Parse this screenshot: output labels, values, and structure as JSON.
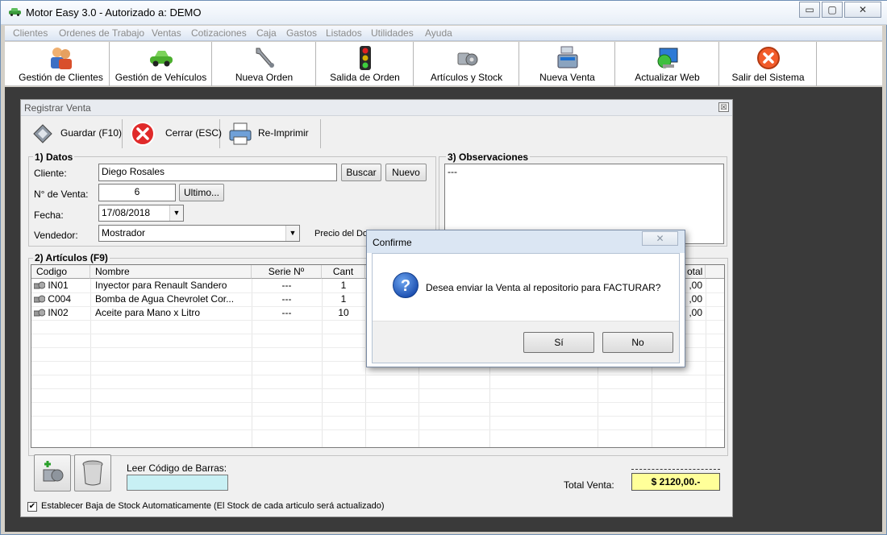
{
  "window": {
    "title": "Motor Easy 3.0 - Autorizado a: DEMO",
    "min": "▭",
    "max": "▢",
    "close": "✕"
  },
  "menu": [
    "Clientes",
    "Ordenes de Trabajo",
    "Ventas",
    "Cotizaciones",
    "Caja",
    "Gastos",
    "Listados",
    "Utilidades",
    "Ayuda"
  ],
  "toolbar": [
    {
      "label": "Gestión de Clientes",
      "icon": "clients-icon"
    },
    {
      "label": "Gestión de Vehículos",
      "icon": "car-icon"
    },
    {
      "label": "Nueva Orden",
      "icon": "wrench-icon"
    },
    {
      "label": "Salida de Orden",
      "icon": "traffic-light-icon"
    },
    {
      "label": "Artículos y Stock",
      "icon": "parts-icon"
    },
    {
      "label": "Nueva Venta",
      "icon": "cash-register-icon"
    },
    {
      "label": "Actualizar Web",
      "icon": "globe-icon"
    },
    {
      "label": "Salir del Sistema",
      "icon": "exit-icon"
    }
  ],
  "child": {
    "title": "Registrar Venta",
    "close": "☒",
    "actions": {
      "save": "Guardar (F10)",
      "close": "Cerrar (ESC)",
      "reprint": "Re-Imprimir"
    },
    "datos": {
      "legend": "1) Datos",
      "cliente_label": "Cliente:",
      "cliente_value": "Diego Rosales",
      "buscar": "Buscar",
      "nuevo": "Nuevo",
      "venta_label": "N° de Venta:",
      "venta_value": "6",
      "ultimo": "Ultimo...",
      "fecha_label": "Fecha:",
      "fecha_value": "17/08/2018",
      "vendedor_label": "Vendedor:",
      "vendedor_value": "Mostrador",
      "precio_label": "Precio del Do"
    },
    "observaciones": {
      "legend": "3) Observaciones",
      "text": "---"
    },
    "articulos": {
      "legend": "2) Artículos (F9)",
      "headers": [
        "Codigo",
        "Nombre",
        "Serie Nº",
        "Cant",
        "otal"
      ],
      "rows": [
        {
          "codigo": "IN01",
          "nombre": "Inyector para Renault Sandero",
          "serie": "---",
          "cant": "1",
          "total": ",00"
        },
        {
          "codigo": "C004",
          "nombre": "Bomba de Agua Chevrolet Cor...",
          "serie": "---",
          "cant": "1",
          "total": ",00"
        },
        {
          "codigo": "IN02",
          "nombre": "Aceite para Mano x Litro",
          "serie": "---",
          "cant": "10",
          "total": ",00"
        }
      ]
    },
    "barcode_label": "Leer Código de Barras:",
    "total_label": "Total Venta:",
    "total_value": "$ 2120,00.-",
    "stock_checkbox": "Establecer Baja de Stock Automaticamente (El Stock de cada articulo será actualizado)",
    "checkmark": "✔"
  },
  "dialog": {
    "title": "Confirme",
    "close": "✕",
    "message": "Desea enviar la Venta al repositorio para FACTURAR?",
    "question_mark": "?",
    "yes": "Sí",
    "no": "No"
  },
  "colors": {
    "accent_blue": "#1f57b5",
    "total_bg": "#ffff99",
    "barcode_bg": "#c8f0f4",
    "mdi_bg": "#3a3a3a"
  }
}
